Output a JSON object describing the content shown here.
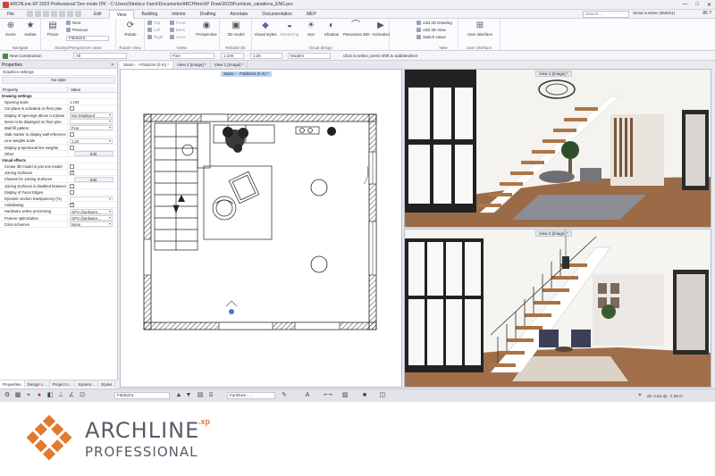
{
  "window": {
    "title": "ARCHLine.XP 2023 Professional 'Dev mode ON' - C:\\Users\\Strelecz Fanni\\Documents\\ARCHline\\XP Draw\\2023\\Furniture_variations_ENG.pro",
    "controls": [
      "—",
      "□",
      "✕"
    ]
  },
  "menu_tabs": [
    "File",
    "Edit",
    "View",
    "Building",
    "Interior",
    "Drafting",
    "Annotate",
    "Documentation",
    "MEP"
  ],
  "active_tab": "View",
  "search_placeholder": "Search...",
  "serial": "Serial number (950521)",
  "help_label": "86 ?",
  "ribbon": {
    "groups": {
      "navigate": "Navigate",
      "storeys": "Storeys/Perspective views",
      "rotate_view": "Rotate View",
      "views": "Views",
      "rebuild": "Rebuild 3D",
      "visual": "Visual design",
      "new": "New",
      "ui": "User interface"
    },
    "buttons": {
      "zoom": "Zoom",
      "isolate": "Isolate",
      "floors": "Floors",
      "next": "Next",
      "previous": "Previous",
      "floorplan": "Földszint",
      "rotate": "Rotate",
      "top": "Top",
      "left": "Left",
      "right": "Right",
      "front": "Front",
      "back": "Back",
      "axon": "Axon",
      "perspective": "Perspective",
      "model3d": "3D model",
      "visual_styles": "Visual styles",
      "rendering": "Rendering",
      "sun": "Sun",
      "shadow": "Shadow",
      "panorama": "Panorama 360",
      "animation": "Animation",
      "add_2d": "Add 2D Drawing",
      "add_3d": "Add 3D View",
      "switch_views": "Switch views",
      "user_interface": "User interface"
    }
  },
  "command_bar": {
    "new_construction": "New Construction",
    "layer": "All",
    "line": "Fine",
    "scale": "1:100",
    "linescale": "1:20",
    "mode": "Modern",
    "hint": "Click to select, press Shift to add/deselect"
  },
  "properties": {
    "title": "Properties",
    "graphics_settings": "Graphics settings",
    "style": "No style",
    "col_property": "Property",
    "col_value": "Value",
    "rows": [
      {
        "type": "section",
        "label": "Drawing settings"
      },
      {
        "type": "value",
        "label": "Opening scale",
        "value": "1:100"
      },
      {
        "type": "check",
        "label": "Cut plane is activated on floor plan",
        "checked": false
      },
      {
        "type": "select",
        "label": "Display of openings above cut plane",
        "value": "Not Displayed"
      },
      {
        "type": "select",
        "label": "Items to be displayed on floor plan",
        "value": ""
      },
      {
        "type": "select",
        "label": "Wall fill pattern",
        "value": "Fine"
      },
      {
        "type": "check",
        "label": "Slab marker to display wall reference",
        "checked": false
      },
      {
        "type": "select",
        "label": "Line weights scale",
        "value": "1:20"
      },
      {
        "type": "check",
        "label": "Display proportional line weights",
        "checked": false
      },
      {
        "type": "button",
        "label": "Other",
        "value": "Edit"
      },
      {
        "type": "section",
        "label": "Visual effects"
      },
      {
        "type": "check",
        "label": "Create 3D model in just one model",
        "checked": false
      },
      {
        "type": "check",
        "label": "Joining Surfaces",
        "checked": true
      },
      {
        "type": "button",
        "label": "Classes for Joining Surfaces",
        "value": "Edit"
      },
      {
        "type": "check",
        "label": "Joining Surfaces is disabled between",
        "checked": false
      },
      {
        "type": "check",
        "label": "Display of Facet Edges",
        "checked": false
      },
      {
        "type": "select",
        "label": "Dynamic section transparency (%)",
        "value": ""
      },
      {
        "type": "check",
        "label": "Antialiasing",
        "checked": true
      },
      {
        "type": "select",
        "label": "Hardware vertex processing",
        "value": "GPU (hardware..."
      },
      {
        "type": "select",
        "label": "Feature optimization",
        "value": "GPU (hardware..."
      },
      {
        "type": "select",
        "label": "Color schemes",
        "value": "None"
      }
    ],
    "tabs": [
      "Properties",
      "Design c...",
      "Project n...",
      "System...",
      "Styles"
    ]
  },
  "view_tabs": [
    "Stairs - - Földszint (0 m) *",
    "View 2 [Image] *",
    "View 1 [Image] *"
  ],
  "plan_label": "Stairs - - Földszint (0 m) *",
  "view1_label": "View 1 [Image] *",
  "view2_label": "View 2 [Image] *",
  "statusbar": {
    "floor": "Földszint",
    "layer": "Furniture - ...",
    "coords": "dx: 2.63    dy: -7.28 m"
  },
  "brand": {
    "name": "ARCHLINE",
    "xp": ".xp",
    "edition": "PROFESSIONAL",
    "orange": "#e07a2e",
    "gray": "#555d68"
  }
}
